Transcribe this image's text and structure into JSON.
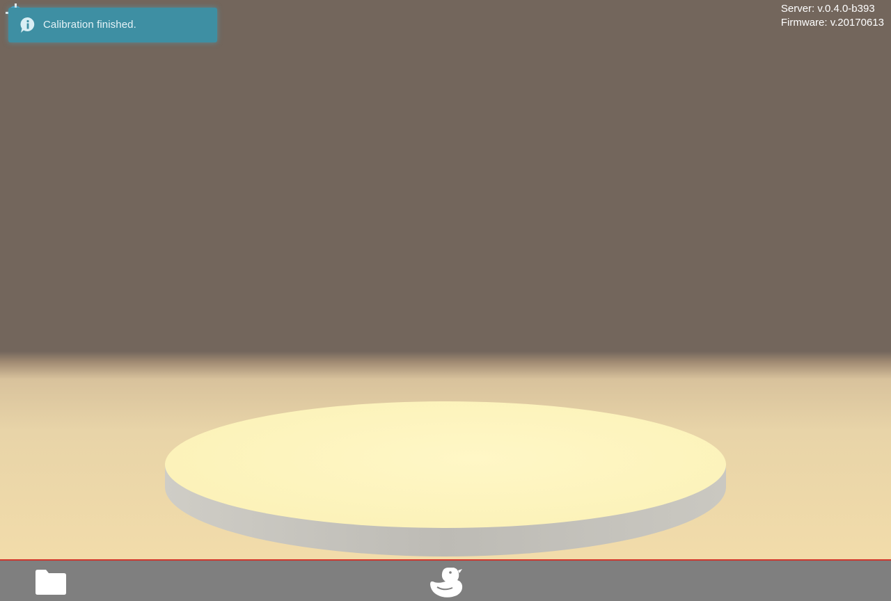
{
  "notification": {
    "message": "Calibration finished.",
    "icon": "info-icon",
    "color": "#3e8fa3"
  },
  "version_info": {
    "server": "Server: v.0.4.0-b393",
    "firmware": "Firmware: v.20170613"
  },
  "scene": {
    "background_color": "#73665c",
    "floor_color": "#f2dcaa",
    "platform_top_color": "#fdf6c2",
    "platform_side_color": "#c8c6c0"
  },
  "toolbar": {
    "accent_color": "#d0362c",
    "background_color": "#7f7f7f",
    "items": [
      {
        "icon": "folder-icon"
      },
      {
        "icon": "duck-icon"
      }
    ]
  }
}
